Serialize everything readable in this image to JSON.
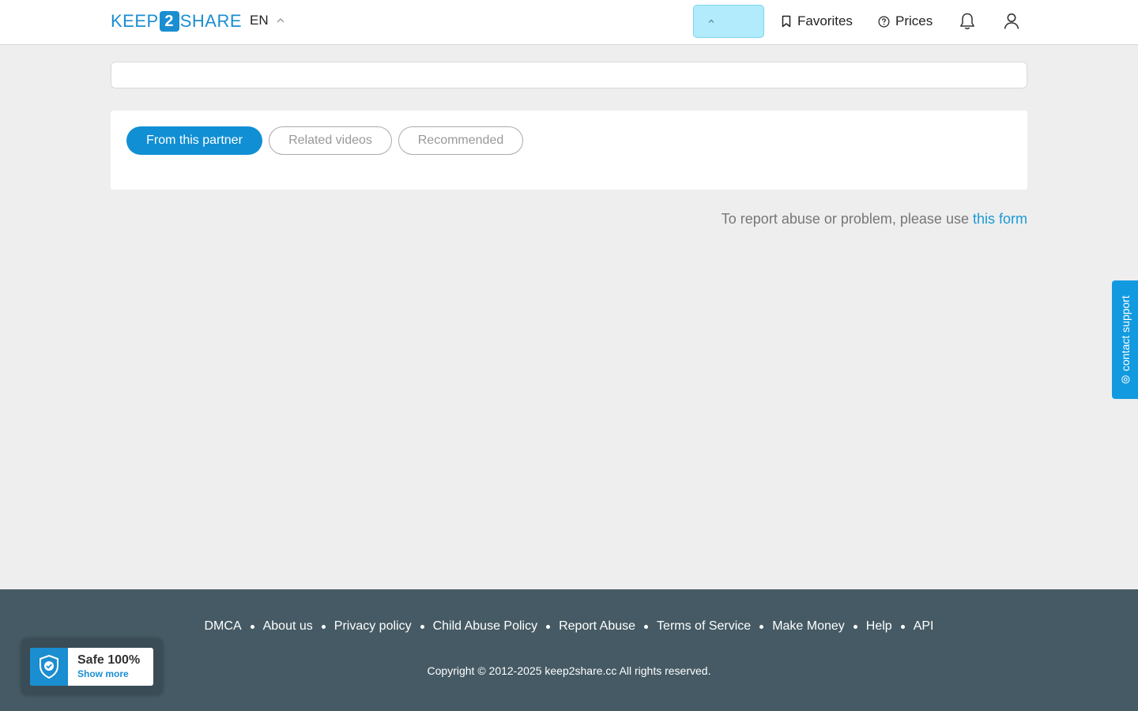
{
  "header": {
    "logo_left": "KEEP",
    "logo_num": "2",
    "logo_right": "SHARE",
    "language": "EN",
    "favorites_label": "Favorites",
    "prices_label": "Prices"
  },
  "tabs": [
    {
      "label": "From this partner",
      "active": true
    },
    {
      "label": "Related videos",
      "active": false
    },
    {
      "label": "Recommended",
      "active": false
    }
  ],
  "report": {
    "text": "To report abuse or problem, please use",
    "link_label": "this form"
  },
  "contact_support": "contact support",
  "footer": {
    "links": [
      "DMCA",
      "About us",
      "Privacy policy",
      "Child Abuse Policy",
      "Report Abuse",
      "Terms of Service",
      "Make Money",
      "Help",
      "API"
    ],
    "copyright": "Copyright © 2012-2025 keep2share.cc All rights reserved."
  },
  "safe_badge": {
    "title": "Safe 100%",
    "more": "Show more"
  },
  "colors": {
    "brand": "#1a8ed1",
    "footer_bg": "#455a64",
    "page_bg": "#eeeeee",
    "highlight": "#b2ebfb",
    "link": "#1a9ad6"
  }
}
